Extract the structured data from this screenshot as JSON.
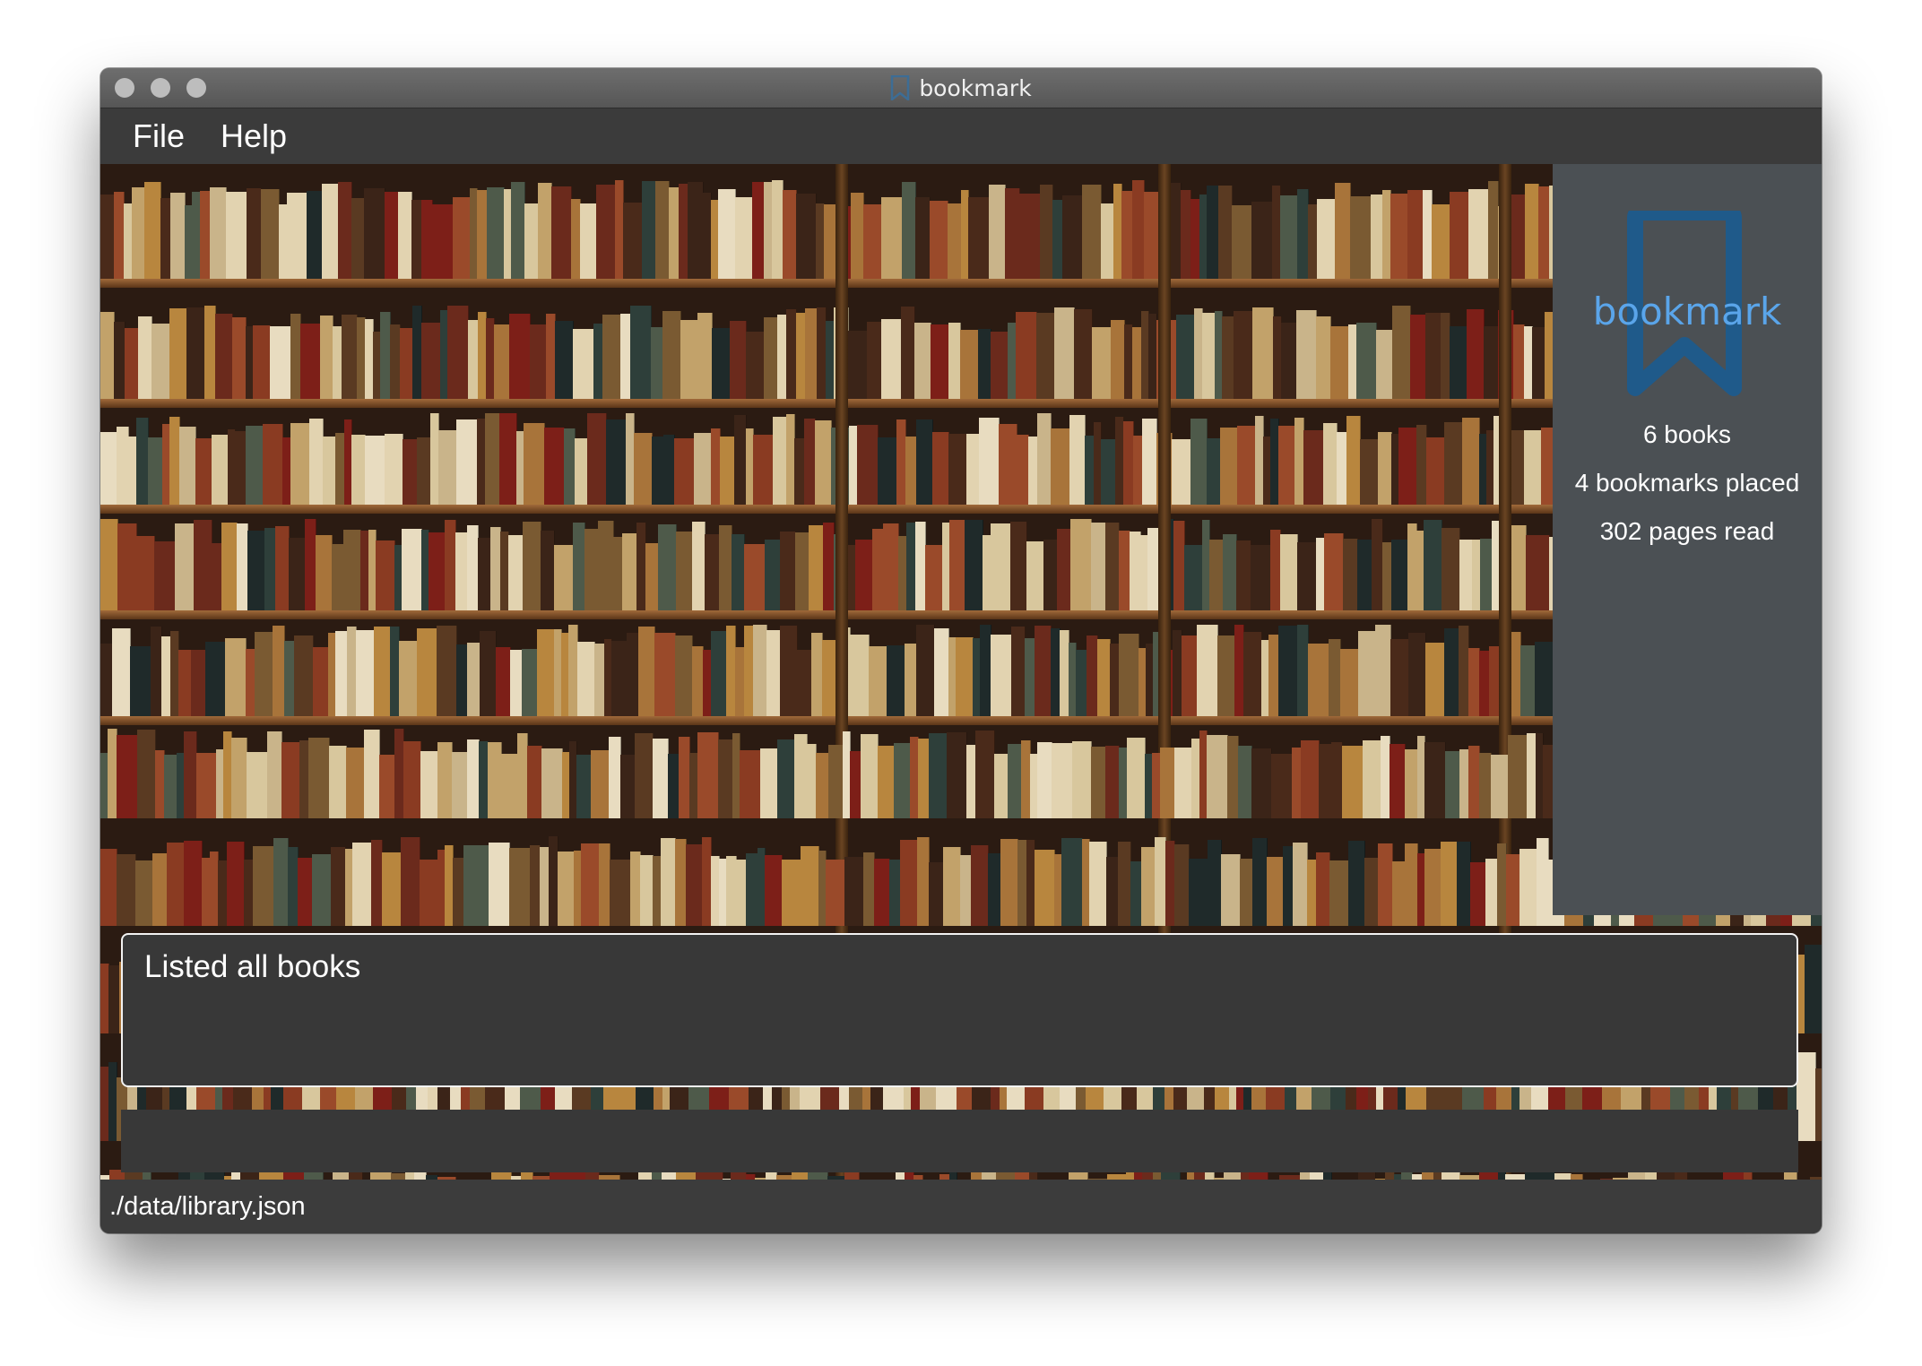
{
  "window": {
    "title": "bookmark"
  },
  "menu": [
    {
      "label": "File"
    },
    {
      "label": "Help"
    }
  ],
  "sidebar": {
    "logo_text": "bookmark",
    "stats": {
      "books": "6 books",
      "bookmarks": "4 bookmarks placed",
      "pages": "302 pages read"
    }
  },
  "result_display": {
    "text": "Listed all books"
  },
  "command_box": {
    "value": "",
    "placeholder": ""
  },
  "status_bar": {
    "file_path": "./data/library.json"
  },
  "colors": {
    "window_bg": "#3a3a3a",
    "sidebar_bg": "#4b5054",
    "logo_dark": "#1f5a8a",
    "logo_text": "#5aa5ea",
    "result_border": "#f2f2f2"
  },
  "icons": [
    "bookmark-icon"
  ]
}
